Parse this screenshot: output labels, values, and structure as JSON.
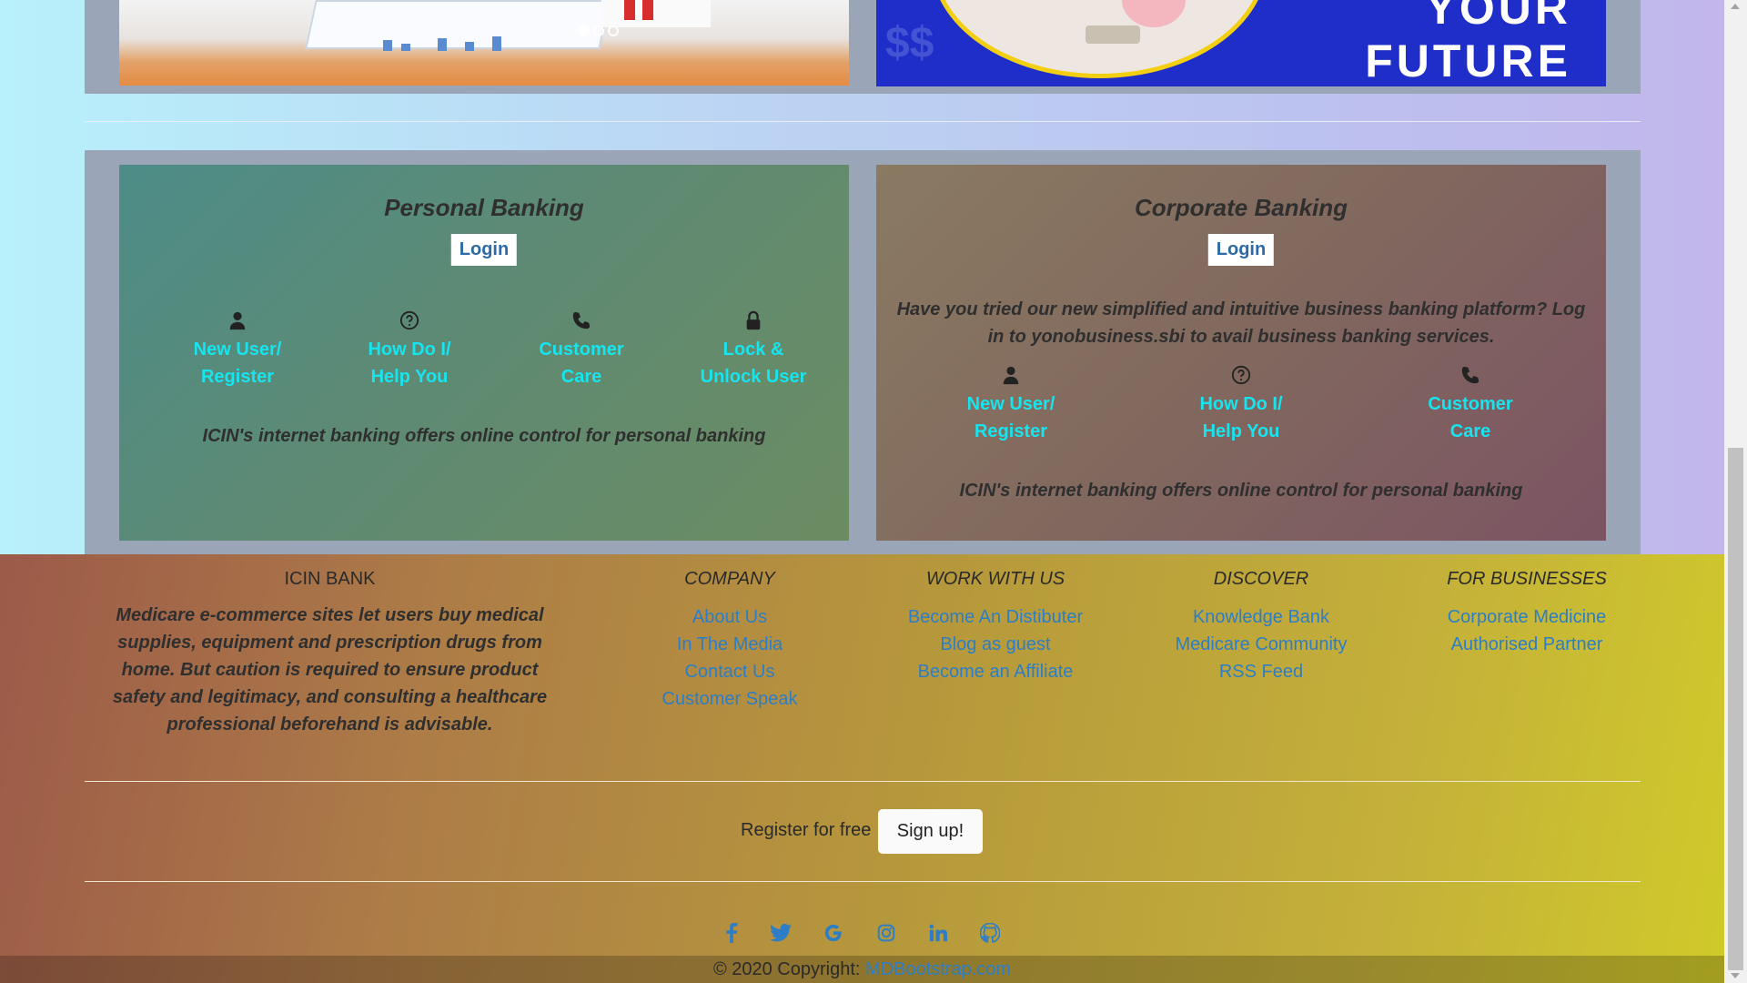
{
  "carousel": {
    "right_banner_text": [
      "YOUR",
      "FUTURE"
    ],
    "right_banner_symbol": "$$"
  },
  "personal": {
    "title": "Personal Banking",
    "login_label": "Login",
    "options": [
      {
        "line1": "New User/",
        "line2": "Register",
        "icon": "user-icon"
      },
      {
        "line1": "How Do I/",
        "line2": "Help You",
        "icon": "question-icon"
      },
      {
        "line1": "Customer",
        "line2": "Care",
        "icon": "phone-icon"
      },
      {
        "line1": "Lock &",
        "line2": "Unlock User",
        "icon": "lock-icon"
      }
    ],
    "description": "ICIN's internet banking offers online control for personal banking"
  },
  "corporate": {
    "title": "Corporate Banking",
    "login_label": "Login",
    "intro_line1": "Have you tried our new simplified and intuitive business banking platform? Log",
    "intro_line2": "in to yonobusiness.sbi to avail business banking services.",
    "options": [
      {
        "line1": "New User/",
        "line2": "Register",
        "icon": "user-icon"
      },
      {
        "line1": "How Do I/",
        "line2": "Help You",
        "icon": "question-icon"
      },
      {
        "line1": "Customer",
        "line2": "Care",
        "icon": "phone-icon"
      }
    ],
    "description": "ICIN's internet banking offers online control for personal banking"
  },
  "footer": {
    "brand_title": "ICIN BANK",
    "about_text": "Medicare e-commerce sites let users buy medical supplies, equipment and prescription drugs from home. But caution is required to ensure product safety and legitimacy, and consulting a healthcare professional beforehand is advisable.",
    "columns": [
      {
        "title": "COMPANY",
        "links": [
          "About Us",
          "In The Media",
          "Contact Us",
          "Customer Speak"
        ]
      },
      {
        "title": "WORK WITH US",
        "links": [
          "Become An Distibuter",
          "Blog as guest",
          "Become an Affiliate"
        ]
      },
      {
        "title": "DISCOVER",
        "links": [
          "Knowledge Bank",
          "Medicare Community",
          "RSS Feed"
        ]
      },
      {
        "title": "FOR BUSINESSES",
        "links": [
          "Corporate Medicine",
          "Authorised Partner"
        ]
      }
    ],
    "register_text": "Register for free",
    "signup_label": "Sign up!",
    "social_icons": [
      "facebook-icon",
      "twitter-icon",
      "google-icon",
      "instagram-icon",
      "linkedin-icon",
      "github-icon"
    ],
    "copyright_prefix": "© 2020 Copyright:",
    "copyright_link": "MDBootstrap.com"
  },
  "colors": {
    "link_cyan": "#16e5ef",
    "link_blue": "#2d7ec6",
    "login_blue": "#2d6aa8"
  }
}
